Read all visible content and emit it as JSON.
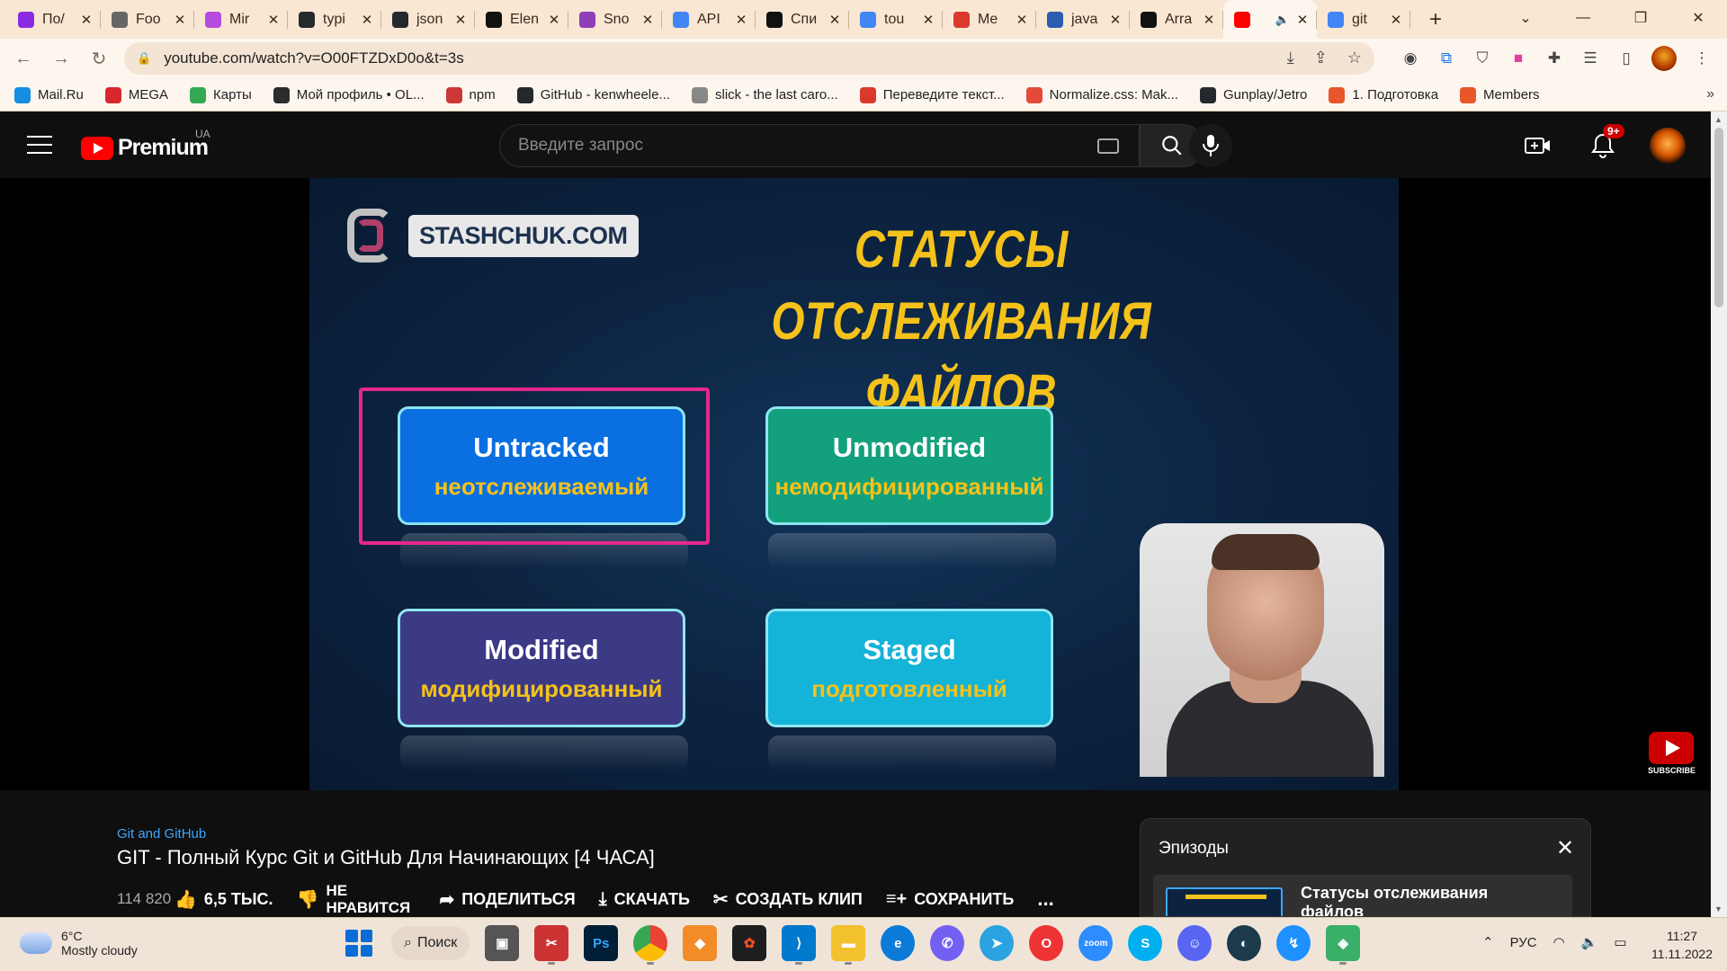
{
  "browser": {
    "tabs": [
      {
        "title": "По/",
        "favicon_color": "#8a2be2"
      },
      {
        "title": "Foo",
        "favicon_color": "#666666"
      },
      {
        "title": "Mir",
        "favicon_color": "#b44ce0"
      },
      {
        "title": "typi",
        "favicon_color": "#24292e"
      },
      {
        "title": "json",
        "favicon_color": "#24292e"
      },
      {
        "title": "Elen",
        "favicon_color": "#111111"
      },
      {
        "title": "Sno",
        "favicon_color": "#8e3fb8"
      },
      {
        "title": "API",
        "favicon_color": "#4285f4"
      },
      {
        "title": "Спи",
        "favicon_color": "#111111"
      },
      {
        "title": "tou",
        "favicon_color": "#4285f4"
      },
      {
        "title": "Me",
        "favicon_color": "#d93a2b"
      },
      {
        "title": "java",
        "favicon_color": "#2a5db0"
      },
      {
        "title": "Arra",
        "favicon_color": "#111111"
      },
      {
        "title": "",
        "favicon_color": "#ff0000",
        "active": true
      },
      {
        "title": "git",
        "favicon_color": "#4285f4"
      }
    ],
    "url": "youtube.com/watch?v=O00FTZDxD0o&t=3s",
    "bookmarks": [
      {
        "label": "Mail.Ru",
        "color": "#168de2"
      },
      {
        "label": "MEGA",
        "color": "#d9272e"
      },
      {
        "label": "Карты",
        "color": "#34a853"
      },
      {
        "label": "Мой профиль • OL...",
        "color": "#2c2c2c"
      },
      {
        "label": "npm",
        "color": "#cb3837"
      },
      {
        "label": "GitHub - kenwheele...",
        "color": "#24292e"
      },
      {
        "label": "slick - the last caro...",
        "color": "#888888"
      },
      {
        "label": "Переведите текст...",
        "color": "#d93a2b"
      },
      {
        "label": "Normalize.css: Mak...",
        "color": "#e5493a"
      },
      {
        "label": "Gunplay/Jetro",
        "color": "#24292e"
      },
      {
        "label": "1. Подготовка",
        "color": "#e8562a"
      },
      {
        "label": "Members",
        "color": "#e8562a"
      }
    ]
  },
  "youtube": {
    "logo_text": "Premium",
    "country_code": "UA",
    "search_placeholder": "Введите запрос",
    "notification_count": "9+"
  },
  "video_frame": {
    "brand_text": "STASHCHUK.COM",
    "title_line1": "СТАТУСЫ ОТСЛЕЖИВАНИЯ",
    "title_line2": "ФАЙЛОВ",
    "cards": [
      {
        "en": "Untracked",
        "ru": "неотслеживаемый",
        "color": "#0a6fe0"
      },
      {
        "en": "Unmodified",
        "ru": "немодифицированный",
        "color": "#13a07c"
      },
      {
        "en": "Modified",
        "ru": "модифицированный",
        "color": "#3c3a85"
      },
      {
        "en": "Staged",
        "ru": "подготовленный",
        "color": "#14b3d8"
      }
    ],
    "highlighted_card": "Untracked",
    "subscribe_label": "SUBSCRIBE"
  },
  "video_info": {
    "channel": "Git and GitHub",
    "title": "GIT - Полный Курс Git и GitHub Для Начинающих [4 ЧАСА]",
    "views": "114 820",
    "likes": "6,5 ТЫС.",
    "dislike_label": "НЕ НРАВИТСЯ",
    "share_label": "ПОДЕЛИТЬСЯ",
    "download_label": "СКАЧАТЬ",
    "clip_label": "СОЗДАТЬ КЛИП",
    "save_label": "СОХРАНИТЬ",
    "more_label": "..."
  },
  "episodes_panel": {
    "title": "Эпизоды",
    "current_episode": "Статусы отслеживания файлов"
  },
  "taskbar": {
    "weather_temp": "6°C",
    "weather_desc": "Mostly cloudy",
    "search_label": "Поиск",
    "language": "РУС",
    "time": "11:27",
    "date": "11.11.2022"
  }
}
